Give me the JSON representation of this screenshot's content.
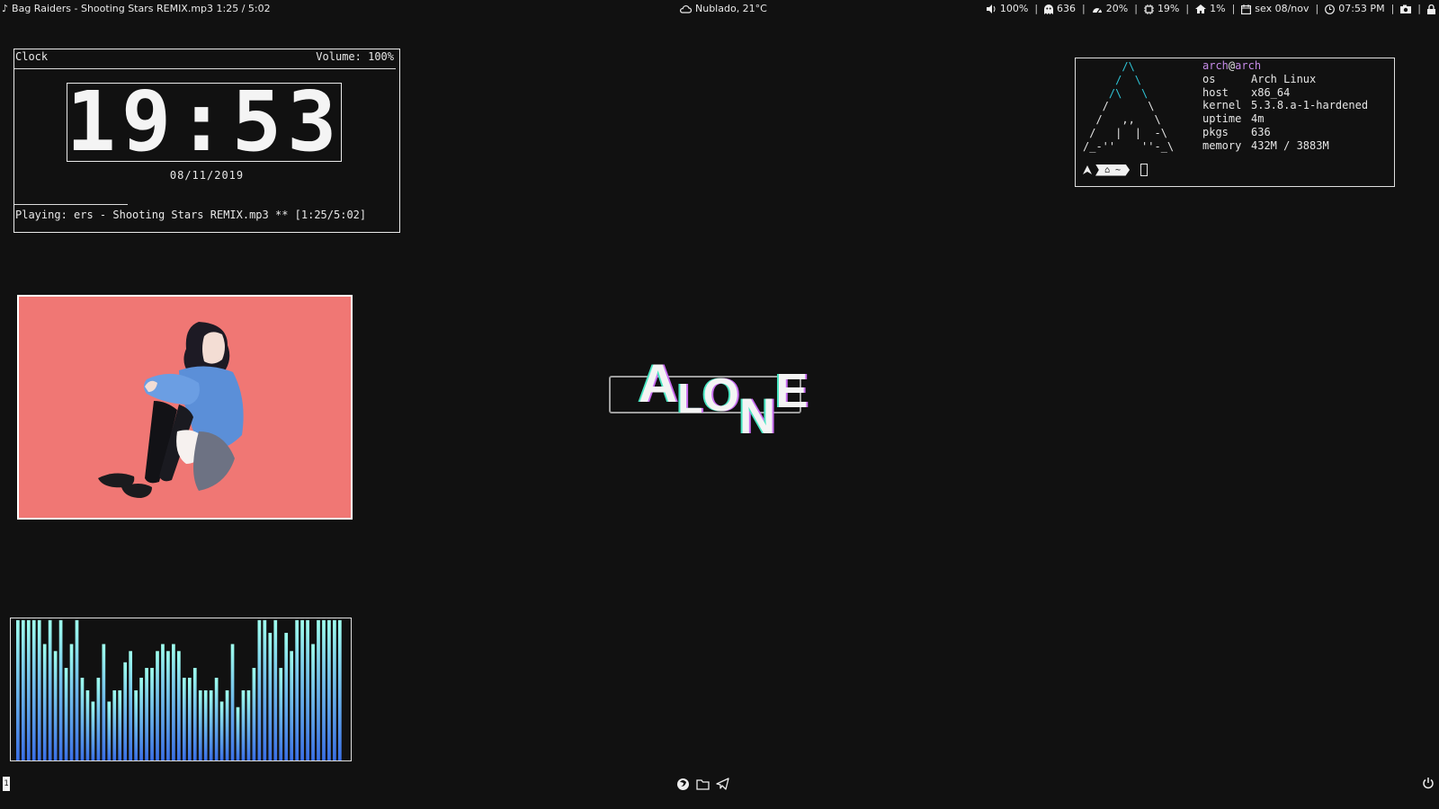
{
  "topbar": {
    "now_playing": "Bag Raiders - Shooting Stars REMIX.mp3 1:25 / 5:02",
    "weather": "Nublado, 21°C",
    "volume": "100%",
    "packages": "636",
    "cpu": "20%",
    "memory": "19%",
    "disk": "1%",
    "date": "sex 08/nov",
    "time": "07:53 PM"
  },
  "clock": {
    "title": "Clock",
    "volume": "Volume: 100%",
    "time": "19:53",
    "date": "08/11/2019",
    "playing": "Playing: ers - Shooting Stars REMIX.mp3 ** [1:25/5:02]"
  },
  "fetch": {
    "user": "arch",
    "at": "@",
    "host": "arch",
    "rows": [
      {
        "key": "os",
        "value": "Arch Linux"
      },
      {
        "key": "host",
        "value": "x86_64"
      },
      {
        "key": "kernel",
        "value": "5.3.8.a-1-hardened"
      },
      {
        "key": "uptime",
        "value": "4m"
      },
      {
        "key": "pkgs",
        "value": "636"
      },
      {
        "key": "memory",
        "value": "432M / 3883M"
      }
    ],
    "prompt_dir": "~"
  },
  "center_logo": {
    "letters": [
      "A",
      "L",
      "O",
      "N",
      "E"
    ]
  },
  "visualizer": {
    "bar_levels": [
      1.0,
      1.0,
      1.0,
      1.0,
      1.0,
      0.83,
      1.0,
      0.78,
      1.0,
      0.66,
      0.83,
      1.0,
      0.59,
      0.5,
      0.42,
      0.59,
      0.83,
      0.42,
      0.5,
      0.5,
      0.7,
      0.78,
      0.5,
      0.59,
      0.66,
      0.66,
      0.78,
      0.83,
      0.78,
      0.83,
      0.78,
      0.59,
      0.59,
      0.66,
      0.5,
      0.5,
      0.5,
      0.59,
      0.42,
      0.5,
      0.83,
      0.38,
      0.5,
      0.5,
      0.66,
      1.0,
      1.0,
      0.91,
      1.0,
      0.66,
      0.91,
      0.78,
      1.0,
      1.0,
      1.0,
      0.83,
      1.0,
      1.0,
      1.0,
      1.0,
      1.0
    ],
    "color_top": "#9fffee",
    "color_bottom": "#3a6fe6"
  },
  "bottombar": {
    "workspace": "1",
    "dock_icons": [
      "firefox-icon",
      "folder-icon",
      "telegram-icon"
    ],
    "power_icon": "power-icon"
  },
  "colors": {
    "background": "#111111",
    "art_background": "#f07774",
    "accent_cyan": "#2fc4d6",
    "accent_purple": "#c68be8"
  }
}
